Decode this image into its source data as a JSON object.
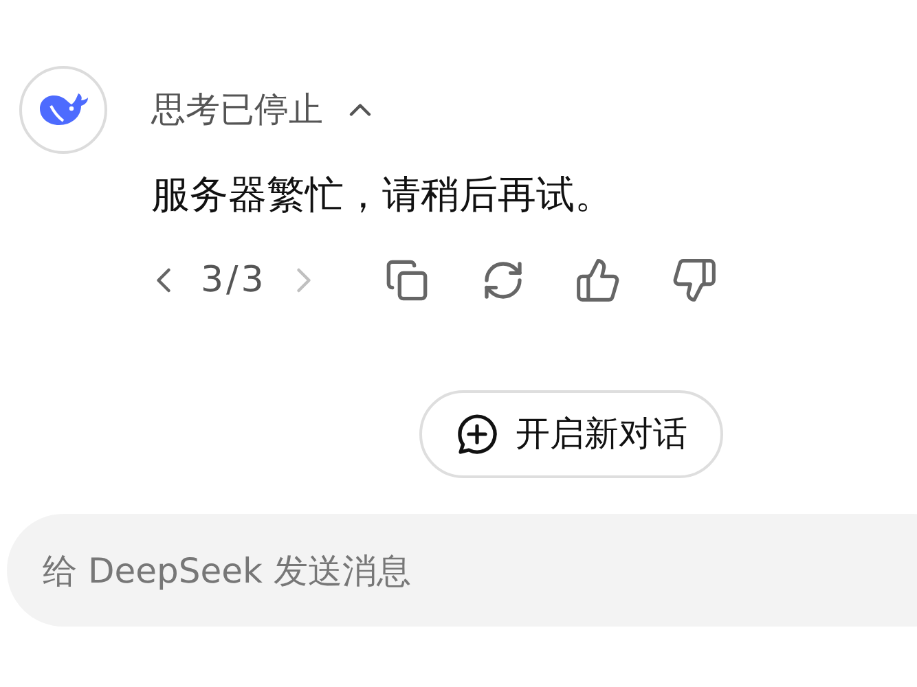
{
  "thinking": {
    "label": "思考已停止",
    "expanded": true
  },
  "message": {
    "text": "服务器繁忙，请稍后再试。"
  },
  "pager": {
    "reading": "3/3",
    "prev_disabled": false,
    "next_disabled": true
  },
  "new_chat_button": {
    "label": "开启新对话"
  },
  "input": {
    "placeholder": "给 DeepSeek 发送消息"
  }
}
